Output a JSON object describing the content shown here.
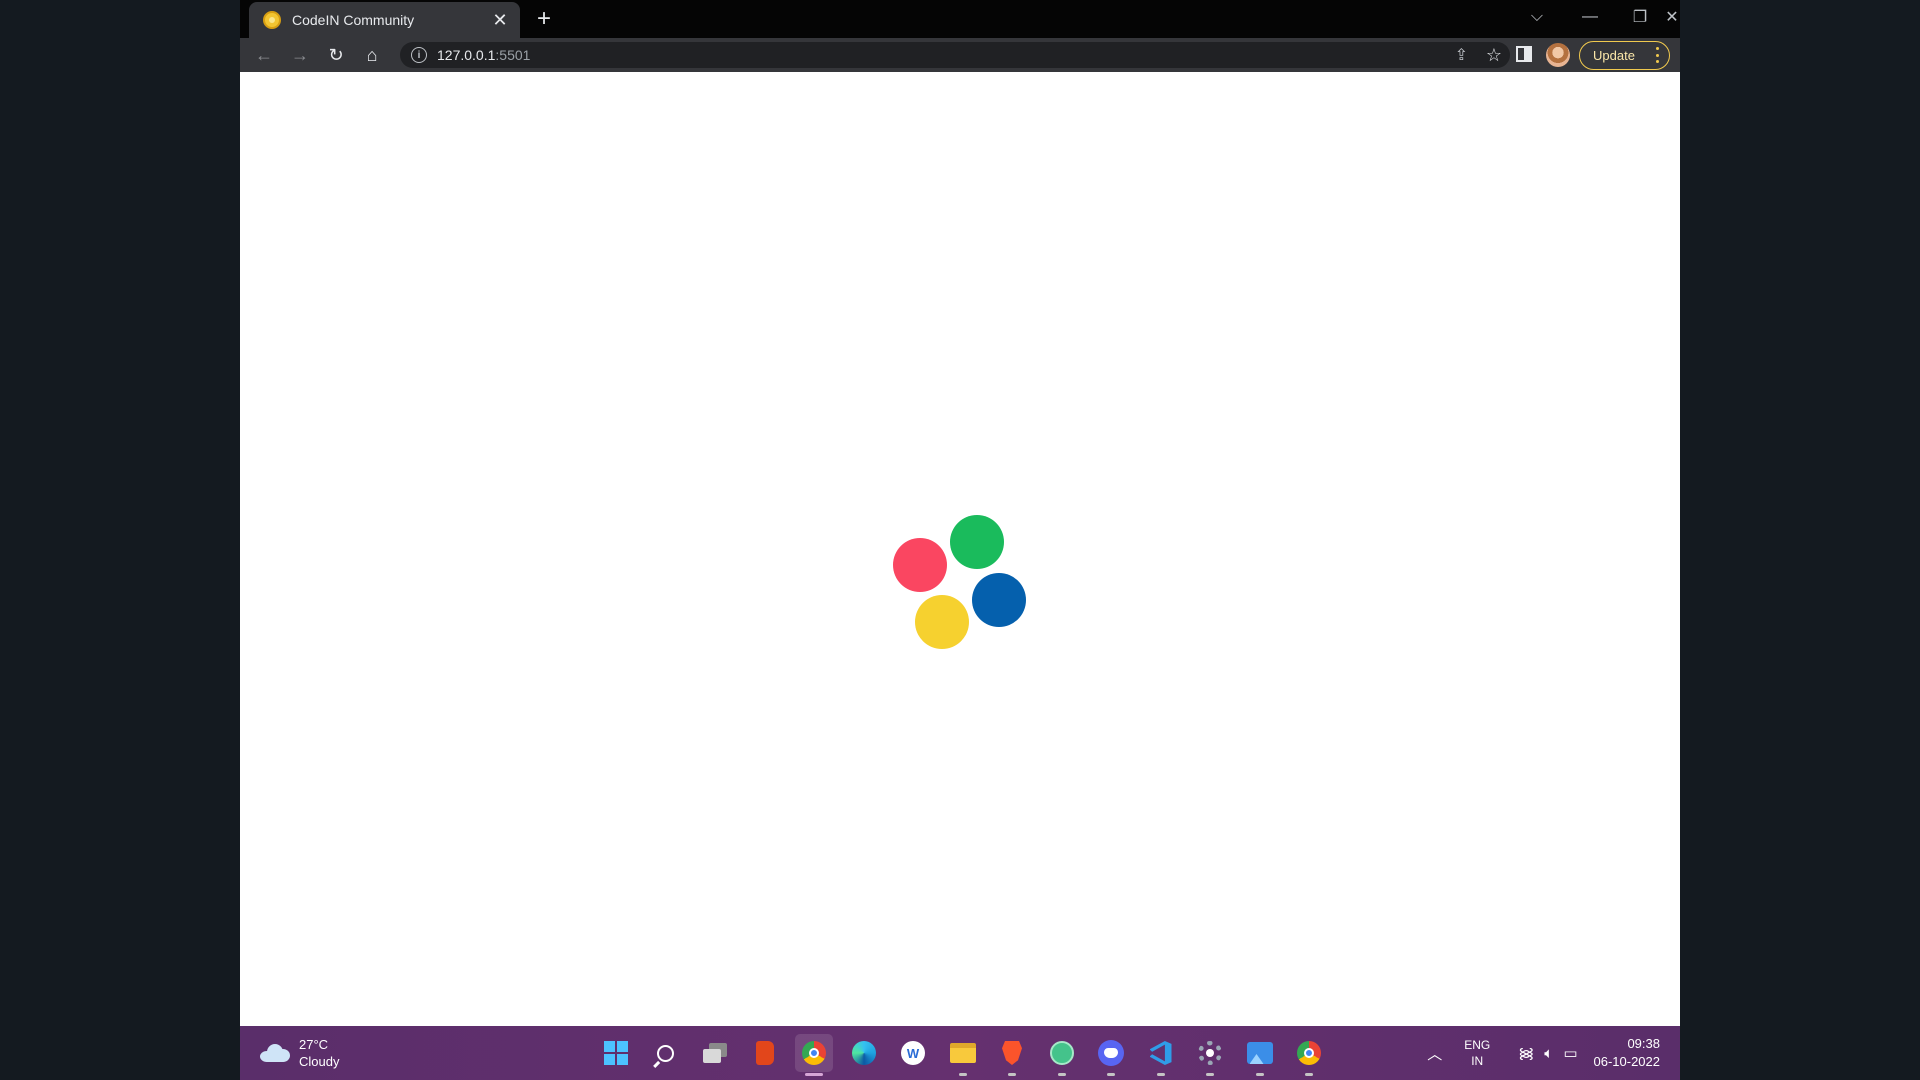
{
  "browser": {
    "tab": {
      "title": "CodeIN Community",
      "close": "✕"
    },
    "new_tab": "+",
    "window_controls": {
      "tab_search": "⌵",
      "minimize": "—",
      "restore": "❐",
      "close": "✕"
    },
    "nav": {
      "back": "←",
      "forward": "→",
      "reload": "↻",
      "home": "⌂"
    },
    "address": {
      "host": "127.0.0.1",
      "port": ":5501"
    },
    "update_label": "Update"
  },
  "loader": {
    "dots": [
      {
        "name": "red-dot",
        "color": "#fa4661"
      },
      {
        "name": "green-dot",
        "color": "#1abb5c"
      },
      {
        "name": "blue-dot",
        "color": "#0560ad"
      },
      {
        "name": "yellow-dot",
        "color": "#f6d12f"
      }
    ]
  },
  "taskbar": {
    "weather": {
      "temp": "27°C",
      "condition": "Cloudy"
    },
    "apps": [
      {
        "name": "start-icon",
        "color": "#4cc2ff"
      },
      {
        "name": "search-icon",
        "color": "#ffffff"
      },
      {
        "name": "task-view-icon",
        "color": "#d9d9d9"
      },
      {
        "name": "office-icon",
        "color": "#e2461b"
      },
      {
        "name": "chrome-icon",
        "color": "#4285f4"
      },
      {
        "name": "edge-icon",
        "color": "#1fa2e0"
      },
      {
        "name": "app-w-icon",
        "color": "#2a6cd6"
      },
      {
        "name": "file-explorer-icon",
        "color": "#f8c93c"
      },
      {
        "name": "brave-icon",
        "color": "#fb542b"
      },
      {
        "name": "atom-icon",
        "color": "#44c38b"
      },
      {
        "name": "discord-icon",
        "color": "#5865f2"
      },
      {
        "name": "vscode-icon",
        "color": "#2f9ce8"
      },
      {
        "name": "settings-icon",
        "color": "#9aa7b5"
      },
      {
        "name": "photos-icon",
        "color": "#3b8ee8"
      },
      {
        "name": "chrome-profile-icon",
        "color": "#4285f4"
      }
    ],
    "tray": {
      "lang_1": "ENG",
      "lang_2": "IN",
      "time": "09:38",
      "date": "06-10-2022"
    }
  }
}
